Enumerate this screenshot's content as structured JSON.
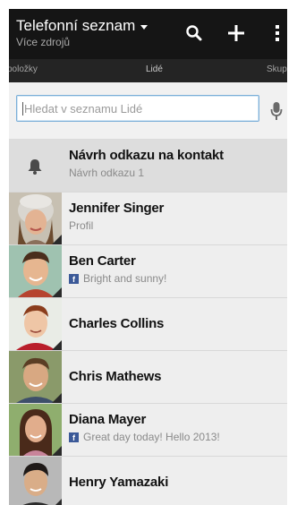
{
  "header": {
    "title": "Telefonní seznam",
    "subtitle": "Více zdrojů",
    "icons": [
      "search-icon",
      "add-icon",
      "overflow-menu-icon"
    ]
  },
  "tabs": {
    "left": "položky",
    "center": "Lidé",
    "right": "Skupi"
  },
  "search": {
    "placeholder": "Hledat v seznamu Lidé",
    "mic_icon": "microphone-icon"
  },
  "suggestion": {
    "icon": "bell-icon",
    "title": "Návrh odkazu na kontakt",
    "subtitle": "Návrh odkazu 1"
  },
  "contacts": [
    {
      "name": "Jennifer Singer",
      "status": "Profil",
      "facebook": false
    },
    {
      "name": "Ben Carter",
      "status": "Bright and sunny!",
      "facebook": true
    },
    {
      "name": "Charles Collins",
      "status": "",
      "facebook": false
    },
    {
      "name": "Chris Mathews",
      "status": "",
      "facebook": false
    },
    {
      "name": "Diana Mayer",
      "status": "Great day today! Hello 2013!",
      "facebook": true
    },
    {
      "name": "Henry Yamazaki",
      "status": "",
      "facebook": false
    }
  ],
  "colors": {
    "action_bar": "#151515",
    "tab_bar": "#242424",
    "search_border": "#7aaed8",
    "facebook": "#3b5998"
  }
}
